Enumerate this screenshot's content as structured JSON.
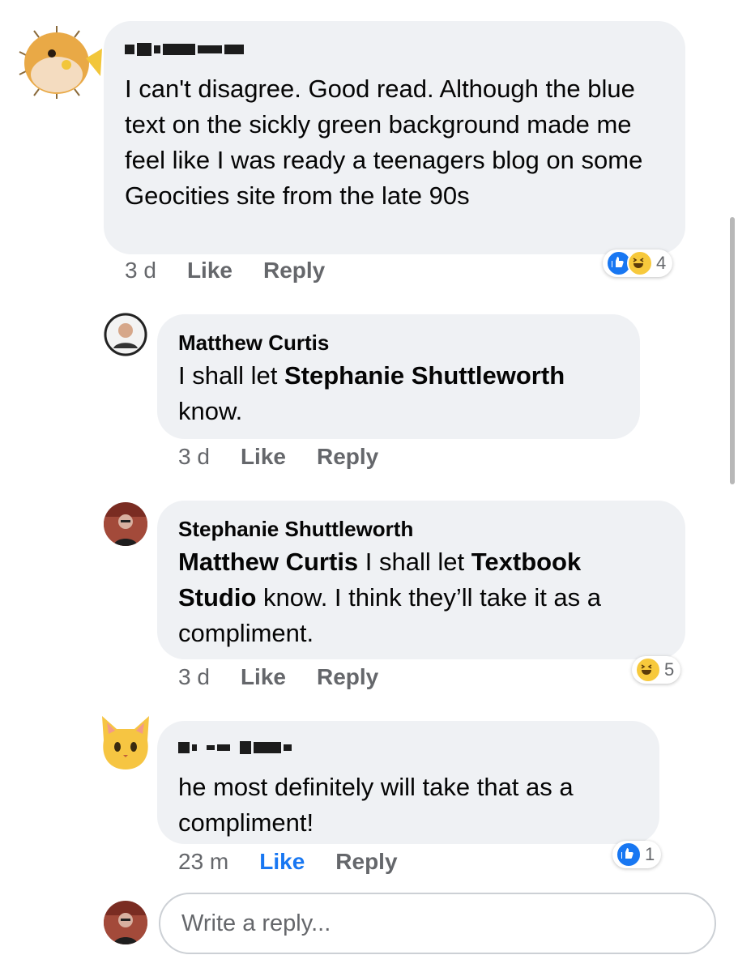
{
  "comments": [
    {
      "author": "",
      "author_redacted": true,
      "text": "I can't disagree. Good read. Although the blue text on the sickly green background made me feel like I was ready a teenagers blog on some Geocities site from the late 90s",
      "time": "3 d",
      "like_label": "Like",
      "reply_label": "Reply",
      "reactions": [
        "like",
        "haha"
      ],
      "reaction_count": "4",
      "avatar": "pufferfish-emoji"
    },
    {
      "author": "Matthew Curtis",
      "text_parts": [
        "I shall let ",
        "Stephanie Shuttleworth",
        " know."
      ],
      "time": "3 d",
      "like_label": "Like",
      "reply_label": "Reply",
      "avatar": "profile-photo"
    },
    {
      "author": "Stephanie Shuttleworth",
      "text_parts": [
        "Matthew Curtis",
        " I shall let ",
        "Textbook Studio",
        " know. I think they’ll take it as a compliment."
      ],
      "time": "3 d",
      "like_label": "Like",
      "reply_label": "Reply",
      "reactions": [
        "haha"
      ],
      "reaction_count": "5",
      "avatar": "profile-photo"
    },
    {
      "author": "",
      "author_redacted": true,
      "text": "he most definitely will take that as a compliment!",
      "time": "23 m",
      "like_label": "Like",
      "like_active": true,
      "reply_label": "Reply",
      "reactions": [
        "like"
      ],
      "reaction_count": "1",
      "avatar": "cat-emoji"
    }
  ],
  "reply_input": {
    "placeholder": "Write a reply..."
  },
  "colors": {
    "bubble": "#eff1f4",
    "muted_text": "#65676b",
    "like_blue": "#1877f2",
    "haha_yellow": "#f7c93c"
  }
}
